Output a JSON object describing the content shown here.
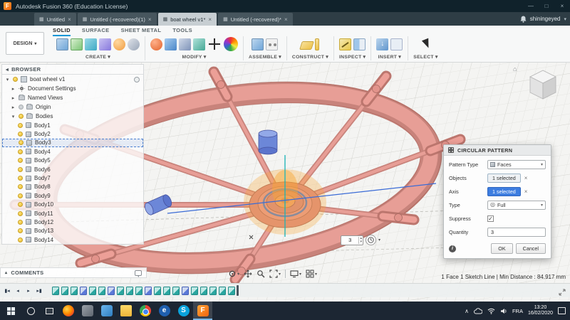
{
  "title_bar": {
    "app_title": "Autodesk Fusion 360 (Education License)",
    "minimize_glyph": "—",
    "maximize_glyph": "□",
    "close_glyph": "×"
  },
  "file_tabs": [
    {
      "label": "Untitled"
    },
    {
      "label": "Untitled (-recovered)(1)"
    },
    {
      "label": "boat wheel v1*"
    },
    {
      "label": "Untitled (-recovered)*"
    }
  ],
  "account": {
    "username": "shiningeyed"
  },
  "ribbon": {
    "design_menu_label": "DESIGN",
    "tabs": [
      {
        "label": "SOLID"
      },
      {
        "label": "SURFACE"
      },
      {
        "label": "SHEET METAL"
      },
      {
        "label": "TOOLS"
      }
    ],
    "active_tab": "SOLID",
    "groups": [
      {
        "label": "CREATE"
      },
      {
        "label": "MODIFY"
      },
      {
        "label": "ASSEMBLE"
      },
      {
        "label": "CONSTRUCT"
      },
      {
        "label": "INSPECT"
      },
      {
        "label": "INSERT"
      },
      {
        "label": "SELECT"
      }
    ]
  },
  "browser": {
    "header": "BROWSER",
    "root_label": "boat wheel v1",
    "nodes": [
      {
        "label": "Document Settings"
      },
      {
        "label": "Named Views"
      },
      {
        "label": "Origin"
      },
      {
        "label": "Bodies"
      }
    ],
    "bodies": [
      "Body1",
      "Body2",
      "Body3",
      "Body4",
      "Body5",
      "Body6",
      "Body7",
      "Body8",
      "Body9",
      "Body10",
      "Body11",
      "Body12",
      "Body13",
      "Body14"
    ],
    "selected_body": "Body3"
  },
  "comments_panel": {
    "label": "COMMENTS"
  },
  "dialog": {
    "title": "CIRCULAR PATTERN",
    "rows": {
      "pattern_type": {
        "label": "Pattern Type",
        "value": "Faces"
      },
      "objects": {
        "label": "Objects",
        "value": "1 selected"
      },
      "axis": {
        "label": "Axis",
        "value": "1 selected"
      },
      "type": {
        "label": "Type",
        "value": "Full"
      },
      "suppress": {
        "label": "Suppress",
        "checked": true
      },
      "quantity": {
        "label": "Quantity",
        "value": "3"
      }
    },
    "ok_label": "OK",
    "cancel_label": "Cancel"
  },
  "canvas": {
    "quantity_hud_value": "3",
    "status_text": "1 Face 1 Sketch Line | Min Distance : 84.917 mm"
  },
  "timeline": {
    "features": [
      "sketch",
      "sketch",
      "sketch",
      "feature",
      "sketch",
      "sketch",
      "feature",
      "sketch",
      "sketch",
      "sketch",
      "feature",
      "sketch",
      "sketch",
      "sketch",
      "feature",
      "sketch",
      "sketch",
      "sketch",
      "sketch",
      "sketch"
    ]
  },
  "taskbar": {
    "language": "FRA",
    "time": "13:20",
    "date": "16/02/2020",
    "apps": [
      {
        "name": "firefox",
        "style": "firefox"
      },
      {
        "name": "gimp",
        "style": "gray"
      },
      {
        "name": "paint",
        "style": "blue"
      },
      {
        "name": "file-explorer",
        "style": "folder"
      },
      {
        "name": "chrome",
        "style": "chrome"
      },
      {
        "name": "edge",
        "style": "edge",
        "letter": "e"
      },
      {
        "name": "skype",
        "style": "skype",
        "letter": "S"
      },
      {
        "name": "fusion-360",
        "style": "fusion",
        "letter": "F",
        "active": true
      }
    ]
  },
  "colors": {
    "accent_blue": "#0696d7",
    "selection_blue": "#3d7de0",
    "model_salmon": "#e59b93",
    "pattern_highlight_orange": "#f5a623"
  }
}
